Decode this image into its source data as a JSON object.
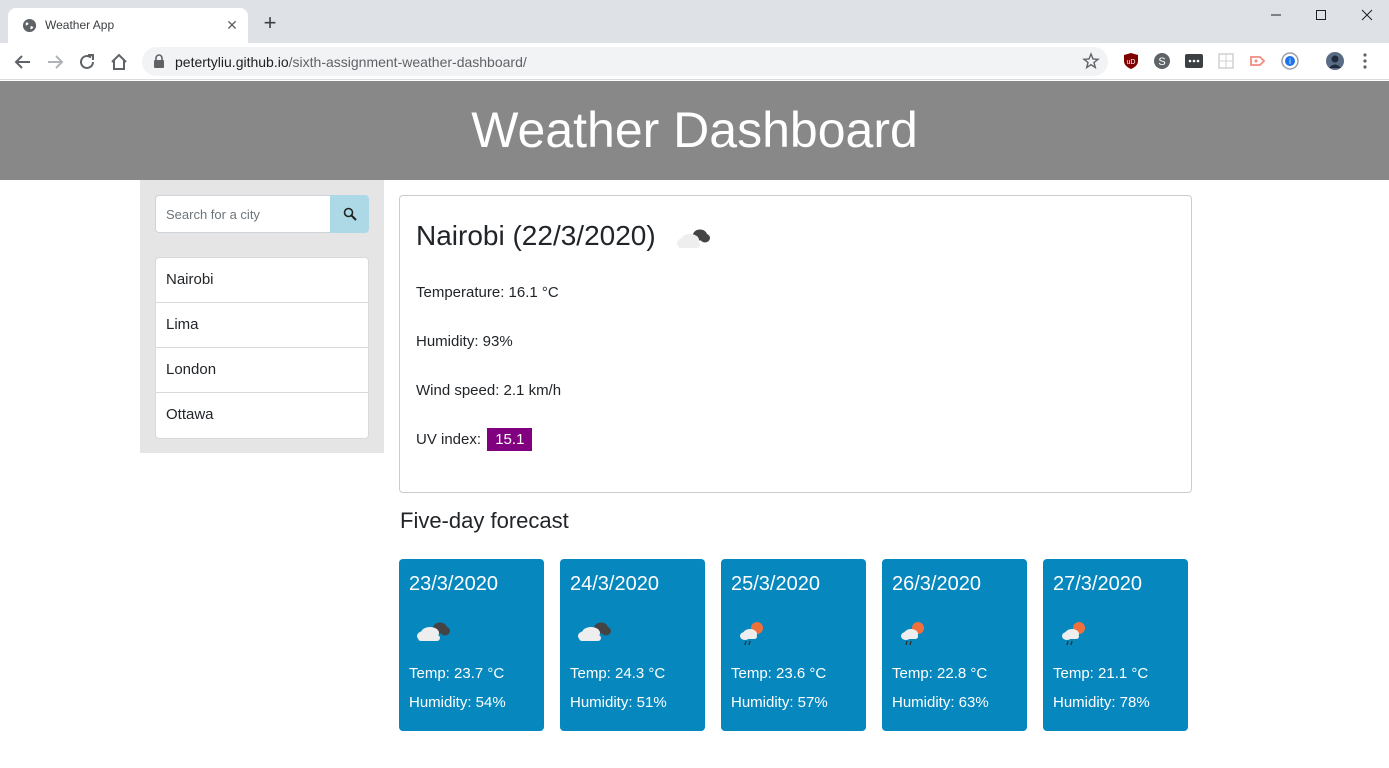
{
  "browser": {
    "tab_title": "Weather App",
    "new_tab_symbol": "+",
    "close_symbol": "✕",
    "url_host": "petertyliu.github.io",
    "url_path": "/sixth-assignment-weather-dashboard/"
  },
  "header": {
    "title": "Weather Dashboard"
  },
  "sidebar": {
    "search_placeholder": "Search for a city",
    "cities": [
      "Nairobi",
      "Lima",
      "London",
      "Ottawa"
    ]
  },
  "current": {
    "title": "Nairobi (22/3/2020)",
    "icon": "cloudy-icon",
    "temperature": "Temperature: 16.1 °C",
    "humidity": "Humidity: 93%",
    "wind": "Wind speed: 2.1 km/h",
    "uv_label": "UV index:",
    "uv_value": "15.1",
    "uv_color": "#800080"
  },
  "forecast": {
    "title": "Five-day forecast",
    "card_color": "#0688bf",
    "days": [
      {
        "date": "23/3/2020",
        "icon": "cloudy-icon",
        "temp": "Temp: 23.7 °C",
        "humidity": "Humidity: 54%"
      },
      {
        "date": "24/3/2020",
        "icon": "cloudy-icon",
        "temp": "Temp: 24.3 °C",
        "humidity": "Humidity: 51%"
      },
      {
        "date": "25/3/2020",
        "icon": "rain-sun-icon",
        "temp": "Temp: 23.6 °C",
        "humidity": "Humidity: 57%"
      },
      {
        "date": "26/3/2020",
        "icon": "rain-sun-icon",
        "temp": "Temp: 22.8 °C",
        "humidity": "Humidity: 63%"
      },
      {
        "date": "27/3/2020",
        "icon": "rain-sun-icon",
        "temp": "Temp: 21.1 °C",
        "humidity": "Humidity: 78%"
      }
    ]
  }
}
